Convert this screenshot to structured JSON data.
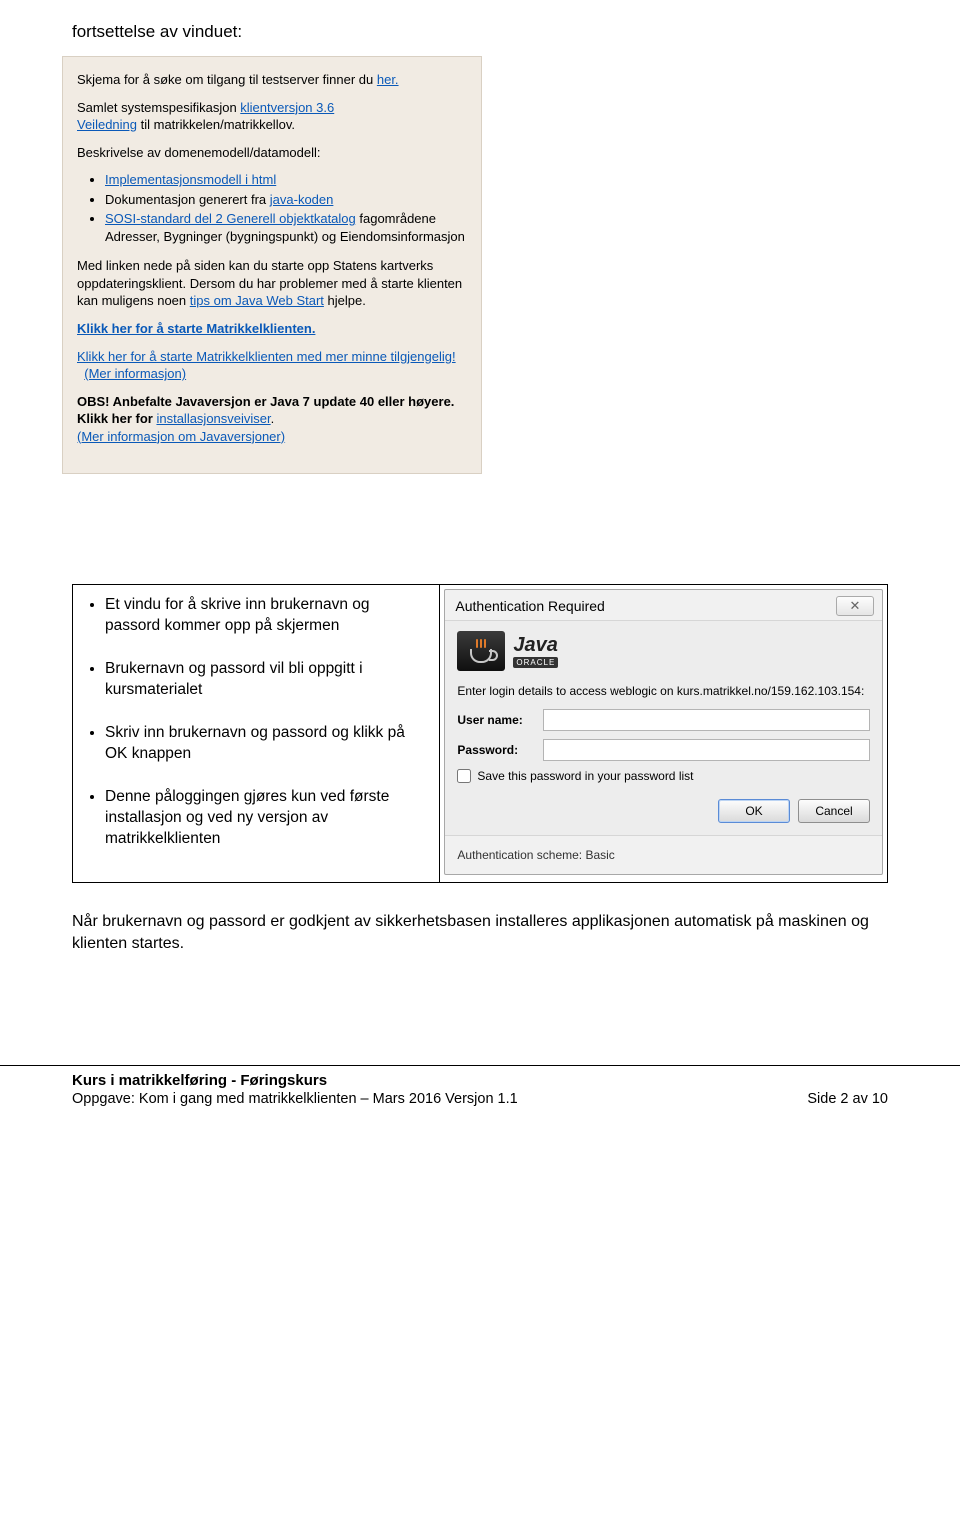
{
  "header": {
    "text": "fortsettelse av vinduet:"
  },
  "webbox": {
    "p1_a": "Skjema for å søke om tilgang til testserver finner du ",
    "p1_link": "her.",
    "p2_a": "Samlet systemspesifikasjon ",
    "p2_link": "klientversjon 3.6",
    "p3_link": "Veiledning",
    "p3_b": " til matrikkelen/matrikkellov.",
    "p4": "Beskrivelse av domenemodell/datamodell:",
    "li1": "Implementasjonsmodell i html",
    "li2_a": "Dokumentasjon generert fra ",
    "li2_link": "java-koden",
    "li3_link": "SOSI-standard del 2 Generell objektkatalog",
    "li3_b": " fagområdene Adresser, Bygninger (bygningspunkt) og Eiendomsinformasjon",
    "p5_a": "Med linken nede på siden kan du starte opp Statens kartverks oppdateringsklient. Dersom du har problemer med å starte klienten kan muligens noen ",
    "p5_link": "tips om Java Web Start",
    "p5_b": " hjelpe.",
    "p6_link": "Klikk her for å starte Matrikkelklienten.",
    "p7_link": "Klikk her for å starte Matrikkelklienten med mer minne tilgjengelig!",
    "p7_more": "(Mer informasjon)",
    "p8_a": "OBS! Anbefalte Javaversjon er Java 7 update 40 eller høyere. Klikk her for ",
    "p8_link1": "installasjonsveiviser",
    "p8_b": ". ",
    "p8_link2": "(Mer informasjon om Javaversjoner)"
  },
  "left_panel": {
    "b1": "Et vindu for å skrive inn brukernavn og passord kommer opp på skjermen",
    "b2": "Brukernavn og passord vil bli oppgitt i kursmaterialet",
    "b3": "Skriv inn brukernavn og passord og klikk på OK knappen",
    "b4": "Denne påloggingen gjøres kun ved første installasjon og ved ny versjon av matrikkelklienten"
  },
  "dialog": {
    "title": "Authentication Required",
    "brand": "Java",
    "oracle": "ORACLE",
    "prompt": "Enter login details to access weblogic on kurs.matrikkel.no/159.162.103.154:",
    "user_label": "User name:",
    "pass_label": "Password:",
    "save_label": "Save this password in your password list",
    "ok": "OK",
    "cancel": "Cancel",
    "scheme": "Authentication scheme: Basic"
  },
  "after": {
    "text": "Når brukernavn og passord er godkjent av sikkerhetsbasen installeres applikasjonen automatisk på maskinen og klienten startes."
  },
  "footer": {
    "title": "Kurs i matrikkelføring - Føringskurs",
    "left": "Oppgave: Kom i gang med matrikkelklienten – Mars 2016 Versjon 1.1",
    "right": "Side 2 av 10"
  }
}
